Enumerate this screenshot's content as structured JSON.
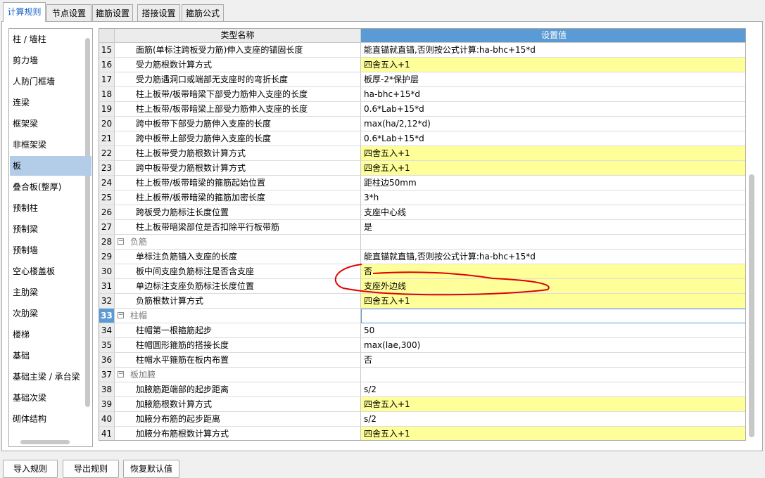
{
  "tabs": [
    "计算规则",
    "节点设置",
    "箍筋设置",
    "搭接设置",
    "箍筋公式"
  ],
  "active_tab": 0,
  "left_list": [
    "柱 / 墙柱",
    "剪力墙",
    "人防门框墙",
    "连梁",
    "框架梁",
    "非框架梁",
    "板",
    "叠合板(整厚)",
    "预制柱",
    "预制梁",
    "预制墙",
    "空心楼盖板",
    "主肋梁",
    "次肋梁",
    "楼梯",
    "基础",
    "基础主梁 / 承台梁",
    "基础次梁",
    "砌体结构"
  ],
  "left_selected": 6,
  "grid": {
    "col_name": "类型名称",
    "col_value": "设置值",
    "rows": [
      {
        "num": "15",
        "name": "面筋(单标注跨板受力筋)伸入支座的锚固长度",
        "value": "能直锚就直锚,否则按公式计算:ha-bhc+15*d",
        "yellow": false
      },
      {
        "num": "16",
        "name": "受力筋根数计算方式",
        "value": "四舍五入+1",
        "yellow": true
      },
      {
        "num": "17",
        "name": "受力筋遇洞口或端部无支座时的弯折长度",
        "value": "板厚-2*保护层",
        "yellow": false
      },
      {
        "num": "18",
        "name": "柱上板带/板带暗梁下部受力筋伸入支座的长度",
        "value": "ha-bhc+15*d",
        "yellow": false
      },
      {
        "num": "19",
        "name": "柱上板带/板带暗梁上部受力筋伸入支座的长度",
        "value": "0.6*Lab+15*d",
        "yellow": false
      },
      {
        "num": "20",
        "name": "跨中板带下部受力筋伸入支座的长度",
        "value": "max(ha/2,12*d)",
        "yellow": false
      },
      {
        "num": "21",
        "name": "跨中板带上部受力筋伸入支座的长度",
        "value": "0.6*Lab+15*d",
        "yellow": false
      },
      {
        "num": "22",
        "name": "柱上板带受力筋根数计算方式",
        "value": "四舍五入+1",
        "yellow": true
      },
      {
        "num": "23",
        "name": "跨中板带受力筋根数计算方式",
        "value": "四舍五入+1",
        "yellow": true
      },
      {
        "num": "24",
        "name": "柱上板带/板带暗梁的箍筋起始位置",
        "value": "距柱边50mm",
        "yellow": false
      },
      {
        "num": "25",
        "name": "柱上板带/板带暗梁的箍筋加密长度",
        "value": "3*h",
        "yellow": false
      },
      {
        "num": "26",
        "name": "跨板受力筋标注长度位置",
        "value": "支座中心线",
        "yellow": false
      },
      {
        "num": "27",
        "name": "柱上板带暗梁部位是否扣除平行板带筋",
        "value": "是",
        "yellow": false
      },
      {
        "num": "28",
        "name": "负筋",
        "value": "",
        "yellow": false,
        "group": true
      },
      {
        "num": "29",
        "name": "单标注负筋锚入支座的长度",
        "value": "能直锚就直锚,否则按公式计算:ha-bhc+15*d",
        "yellow": false
      },
      {
        "num": "30",
        "name": "板中间支座负筋标注是否含支座",
        "value": "否",
        "yellow": true
      },
      {
        "num": "31",
        "name": "单边标注支座负筋标注长度位置",
        "value": "支座外边线",
        "yellow": true
      },
      {
        "num": "32",
        "name": "负筋根数计算方式",
        "value": "四舍五入+1",
        "yellow": true
      },
      {
        "num": "33",
        "name": "柱帽",
        "value": "",
        "yellow": false,
        "group": true,
        "current": true
      },
      {
        "num": "34",
        "name": "柱帽第一根箍筋起步",
        "value": "50",
        "yellow": false
      },
      {
        "num": "35",
        "name": "柱帽圆形箍筋的搭接长度",
        "value": "max(lae,300)",
        "yellow": false
      },
      {
        "num": "36",
        "name": "柱帽水平箍筋在板内布置",
        "value": "否",
        "yellow": false
      },
      {
        "num": "37",
        "name": "板加腋",
        "value": "",
        "yellow": false,
        "group": true
      },
      {
        "num": "38",
        "name": "加腋筋距端部的起步距离",
        "value": "s/2",
        "yellow": false
      },
      {
        "num": "39",
        "name": "加腋筋根数计算方式",
        "value": "四舍五入+1",
        "yellow": true
      },
      {
        "num": "40",
        "name": "加腋分布筋的起步距离",
        "value": "s/2",
        "yellow": false
      },
      {
        "num": "41",
        "name": "加腋分布筋根数计算方式",
        "value": "四舍五入+1",
        "yellow": true
      }
    ]
  },
  "buttons": {
    "import": "导入规则",
    "export": "导出规则",
    "restore": "恢复默认值"
  },
  "colors": {
    "header_accent": "#5b9bd5",
    "highlight": "#ffff99",
    "selection": "#b3cde8",
    "annotation": "#e00000"
  }
}
